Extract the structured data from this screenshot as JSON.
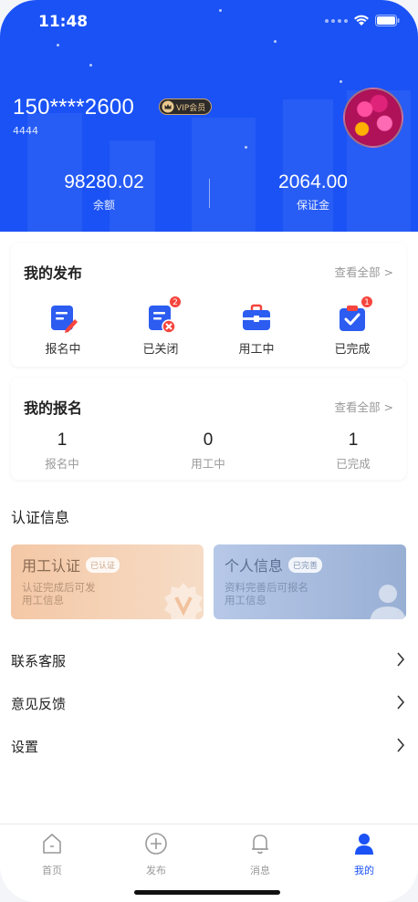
{
  "status_bar": {
    "time": "11:48"
  },
  "profile": {
    "phone": "150****2600",
    "vip_label": "VIP会员",
    "sub_id": "4444"
  },
  "stats": [
    {
      "value": "98280.02",
      "label": "余额"
    },
    {
      "value": "2064.00",
      "label": "保证金"
    }
  ],
  "my_publish": {
    "title": "我的发布",
    "view_all": "查看全部 >",
    "items": [
      {
        "label": "报名中",
        "icon": "form-edit-icon",
        "badge": ""
      },
      {
        "label": "已关闭",
        "icon": "form-closed-icon",
        "badge": "2"
      },
      {
        "label": "用工中",
        "icon": "briefcase-icon",
        "badge": ""
      },
      {
        "label": "已完成",
        "icon": "clipboard-check-icon",
        "badge": "1"
      }
    ]
  },
  "my_signup": {
    "title": "我的报名",
    "view_all": "查看全部 >",
    "items": [
      {
        "count": "1",
        "label": "报名中"
      },
      {
        "count": "0",
        "label": "用工中"
      },
      {
        "count": "1",
        "label": "已完成"
      }
    ]
  },
  "auth": {
    "title": "认证信息",
    "cards": [
      {
        "title": "用工认证",
        "tag": "已认证",
        "desc": [
          "认证完成后可发",
          "用工信息"
        ],
        "icon": "verified-v-icon"
      },
      {
        "title": "个人信息",
        "tag": "已完善",
        "desc": [
          "资料完善后可报名",
          "用工信息"
        ],
        "icon": "person-icon"
      }
    ]
  },
  "menu": [
    {
      "label": "联系客服"
    },
    {
      "label": "意见反馈"
    },
    {
      "label": "设置"
    }
  ],
  "tabbar": [
    {
      "label": "首页",
      "icon": "home-icon",
      "active": false
    },
    {
      "label": "发布",
      "icon": "plus-circle-icon",
      "active": false
    },
    {
      "label": "消息",
      "icon": "bell-icon",
      "active": false
    },
    {
      "label": "我的",
      "icon": "user-icon",
      "active": true
    }
  ],
  "colors": {
    "primary": "#1a52f5",
    "badge": "#f5453d",
    "auth_warm": "#f2c4a0",
    "auth_cool": "#a9bde0"
  }
}
